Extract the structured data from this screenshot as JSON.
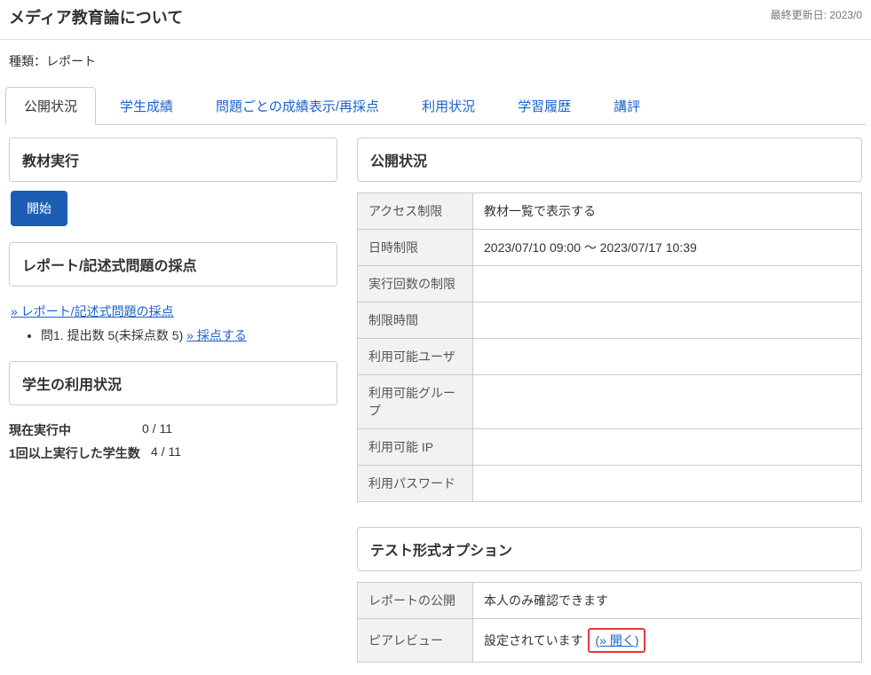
{
  "header": {
    "title": "メディア教育論について",
    "last_updated_label": "最終更新日: 2023/0",
    "type_label": "種類：レポート"
  },
  "tabs": [
    {
      "label": "公開状況"
    },
    {
      "label": "学生成績"
    },
    {
      "label": "問題ごとの成績表示/再採点"
    },
    {
      "label": "利用状況"
    },
    {
      "label": "学習履歴"
    },
    {
      "label": "講評"
    }
  ],
  "left": {
    "exec_title": "教材実行",
    "start_button": "開始",
    "grading_title": "レポート/記述式問題の採点",
    "grading_link": "» レポート/記述式問題の採点",
    "q_prefix": "問1. 提出数 5(未採点数 5) ",
    "score_link": "» 採点する",
    "usage_title": "学生の利用状況",
    "stat1_label": "現在実行中",
    "stat1_value": "0 / 11",
    "stat2_label": "1回以上実行した学生数",
    "stat2_value": "4 / 11"
  },
  "right": {
    "status_title": "公開状況",
    "status_rows": [
      {
        "label": "アクセス制限",
        "value": "教材一覧で表示する"
      },
      {
        "label": "日時制限",
        "value": "2023/07/10 09:00 〜 2023/07/17 10:39"
      },
      {
        "label": "実行回数の制限",
        "value": ""
      },
      {
        "label": "制限時間",
        "value": ""
      },
      {
        "label": "利用可能ユーザ",
        "value": ""
      },
      {
        "label": "利用可能グループ",
        "value": ""
      },
      {
        "label": "利用可能 IP",
        "value": ""
      },
      {
        "label": "利用パスワード",
        "value": ""
      }
    ],
    "options_title": "テスト形式オプション",
    "opt_row1_label": "レポートの公開",
    "opt_row1_value": "本人のみ確認できます",
    "opt_row2_label": "ピアレビュー",
    "opt_row2_value": "設定されています ",
    "opt_open_link": "(» 開く)"
  }
}
